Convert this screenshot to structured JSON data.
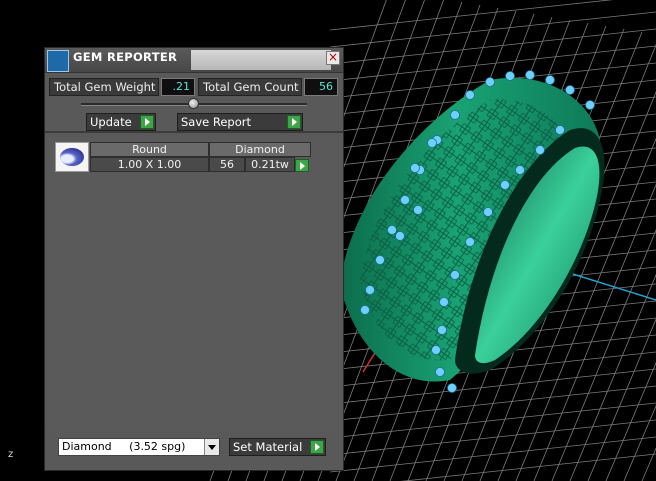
{
  "panel": {
    "title": "GEM REPORTER",
    "close_glyph": "×",
    "logo_icon": "gem-reporter-logo-icon"
  },
  "stats": {
    "weight_label": "Total Gem Weight",
    "weight_value": ".21",
    "count_label": "Total Gem Count",
    "count_value": "56"
  },
  "buttons": {
    "update": "Update",
    "save_report": "Save Report",
    "set_material": "Set Material"
  },
  "gem_table": {
    "headers": [
      "Round",
      "Diamond"
    ],
    "rows": [
      {
        "size": "1.00 X 1.00",
        "count": "56",
        "weight": "0.21tw"
      }
    ]
  },
  "material_select": {
    "value": "Diamond     (3.52 spg)"
  },
  "viewport": {
    "axis_label": "z",
    "ring_color": "#1aa377",
    "gem_color": "#6ed0ff",
    "grid_color": "#8a8a8a"
  }
}
